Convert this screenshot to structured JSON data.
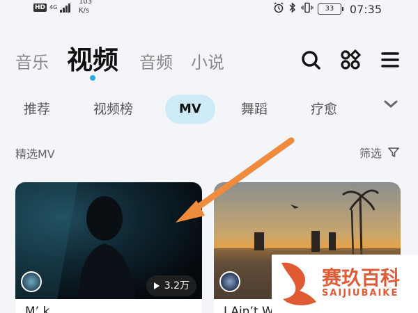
{
  "status_bar": {
    "hd": "HD",
    "network": "4G",
    "speed_value": "103",
    "speed_unit": "K/s",
    "battery": "33",
    "time": "07:35"
  },
  "top_nav": {
    "tabs": [
      "音乐",
      "视频",
      "音频",
      "小说"
    ],
    "active_index": 1
  },
  "categories": {
    "items": [
      "推荐",
      "视频榜",
      "MV",
      "舞蹈",
      "疗愈"
    ],
    "active_index": 2
  },
  "section": {
    "title": "精选MV",
    "filter_label": "筛选"
  },
  "cards": [
    {
      "play_count": "3.2万",
      "title": "M’ k"
    },
    {
      "title": "I Ain’t Worried"
    }
  ],
  "watermark": {
    "text": "赛玖百科",
    "sub": "SAIJIUBAIKE"
  },
  "colors": {
    "accent": "#2ba9e6",
    "chip_active_bg": "#cdeaf8",
    "arrow": "#f08a3c",
    "watermark": "#e05a34"
  }
}
